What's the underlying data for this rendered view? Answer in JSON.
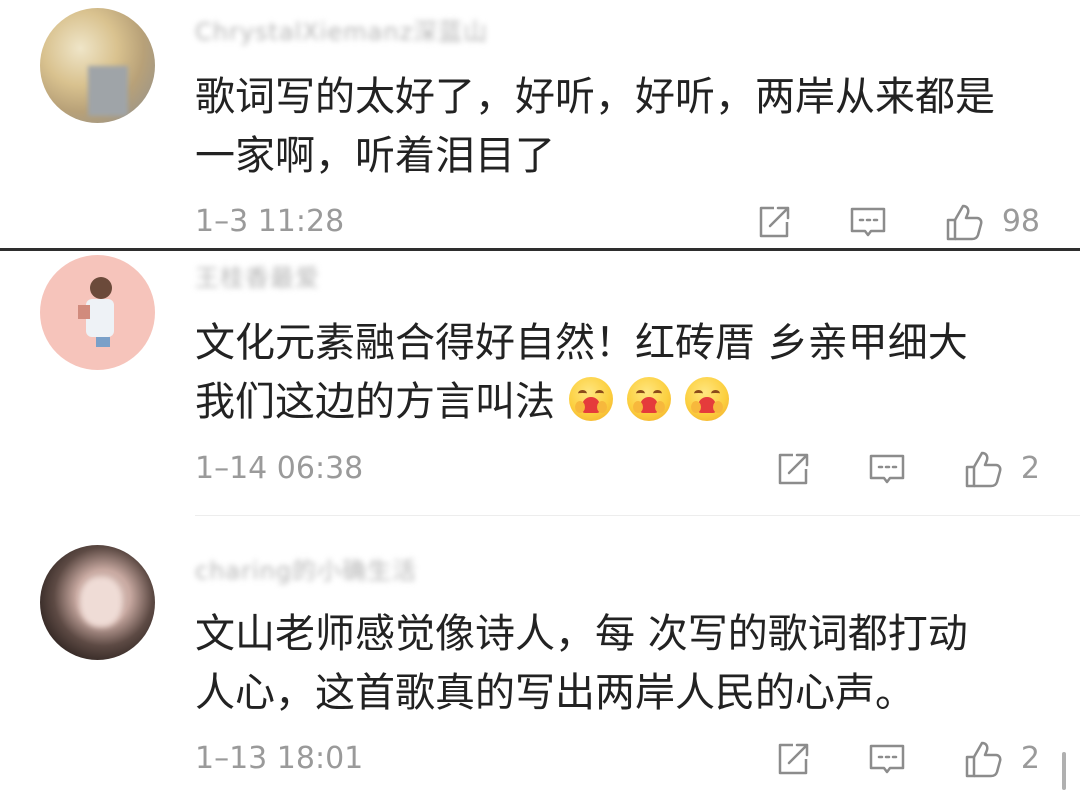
{
  "comments": [
    {
      "username": "ChrystalXiemanz深蓝山",
      "text_lines": [
        "歌词写的太好了，好听，好听，两岸从来都是",
        "一家啊，听着泪目了"
      ],
      "timestamp": "1–3 11:28",
      "likes": "98",
      "emojis": []
    },
    {
      "username": "王桂香最爱",
      "text_lines": [
        "文化元素融合得好自然！红砖厝  乡亲甲细大",
        "我们这边的方言叫法"
      ],
      "timestamp": "1–14 06:38",
      "likes": "2",
      "emojis": [
        "hug-heart",
        "hug-heart",
        "hug-heart"
      ]
    },
    {
      "username": "charing的小确生活",
      "text_lines": [
        "文山老师感觉像诗人，每 次写的歌词都打动",
        "人心，这首歌真的写出两岸人民的心声。"
      ],
      "timestamp": "1–13 18:01",
      "likes": "2",
      "emojis": []
    }
  ],
  "icons": {
    "share": "share-icon",
    "reply": "reply-comment-icon",
    "like": "thumbs-up-icon",
    "emoji": "hug-heart-emoji"
  },
  "colors": {
    "text": "#222222",
    "meta": "#9a9a9a",
    "username_blurred": "#b6b6b6",
    "divider": "#2e2e2e"
  }
}
